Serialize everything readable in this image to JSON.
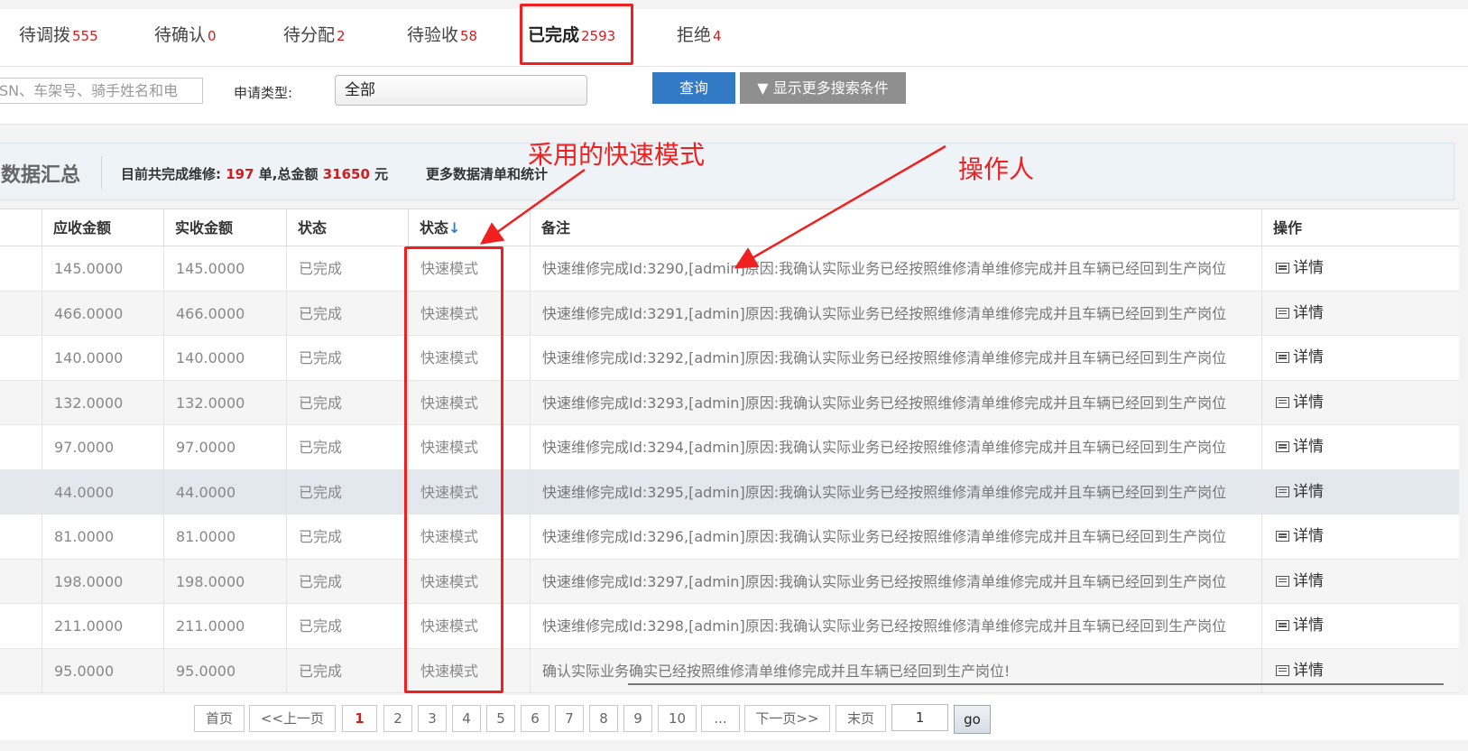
{
  "tabs": [
    {
      "label": "待调拨",
      "count": "555"
    },
    {
      "label": "待确认",
      "count": "0"
    },
    {
      "label": "待分配",
      "count": "2"
    },
    {
      "label": "待验收",
      "count": "58"
    },
    {
      "label": "已完成",
      "count": "2593"
    },
    {
      "label": "拒绝",
      "count": "4"
    }
  ],
  "search": {
    "placeholder": "SN、车架号、骑手姓名和电",
    "type_label": "申请类型:",
    "type_value": "全部",
    "query_label": "查询",
    "more_label": "▼ 显示更多搜索条件"
  },
  "summary": {
    "title": "数据汇总",
    "prefix": "目前共完成维修:",
    "count": "197",
    "mid": " 单,总金额 ",
    "amount": "31650",
    "suffix": " 元",
    "more_link": "更多数据清单和统计"
  },
  "table": {
    "headers": [
      "应收金额",
      "实收金额",
      "状态",
      "状态",
      "备注",
      "操作"
    ],
    "sort_icon": "↓",
    "rows": [
      [
        "145.0000",
        "145.0000",
        "已完成",
        "快速模式",
        "快速维修完成Id:3290,[admin]原因:我确认实际业务已经按照维修清单维修完成并且车辆已经回到生产岗位",
        "详情"
      ],
      [
        "466.0000",
        "466.0000",
        "已完成",
        "快速模式",
        "快速维修完成Id:3291,[admin]原因:我确认实际业务已经按照维修清单维修完成并且车辆已经回到生产岗位",
        "详情"
      ],
      [
        "140.0000",
        "140.0000",
        "已完成",
        "快速模式",
        "快速维修完成Id:3292,[admin]原因:我确认实际业务已经按照维修清单维修完成并且车辆已经回到生产岗位",
        "详情"
      ],
      [
        "132.0000",
        "132.0000",
        "已完成",
        "快速模式",
        "快速维修完成Id:3293,[admin]原因:我确认实际业务已经按照维修清单维修完成并且车辆已经回到生产岗位",
        "详情"
      ],
      [
        "97.0000",
        "97.0000",
        "已完成",
        "快速模式",
        "快速维修完成Id:3294,[admin]原因:我确认实际业务已经按照维修清单维修完成并且车辆已经回到生产岗位",
        "详情"
      ],
      [
        "44.0000",
        "44.0000",
        "已完成",
        "快速模式",
        "快速维修完成Id:3295,[admin]原因:我确认实际业务已经按照维修清单维修完成并且车辆已经回到生产岗位",
        "详情"
      ],
      [
        "81.0000",
        "81.0000",
        "已完成",
        "快速模式",
        "快速维修完成Id:3296,[admin]原因:我确认实际业务已经按照维修清单维修完成并且车辆已经回到生产岗位",
        "详情"
      ],
      [
        "198.0000",
        "198.0000",
        "已完成",
        "快速模式",
        "快速维修完成Id:3297,[admin]原因:我确认实际业务已经按照维修清单维修完成并且车辆已经回到生产岗位",
        "详情"
      ],
      [
        "211.0000",
        "211.0000",
        "已完成",
        "快速模式",
        "快速维修完成Id:3298,[admin]原因:我确认实际业务已经按照维修清单维修完成并且车辆已经回到生产岗位",
        "详情"
      ],
      [
        "95.0000",
        "95.0000",
        "已完成",
        "快速模式",
        "确认实际业务确实已经按照维修清单维修完成并且车辆已经回到生产岗位!",
        "详情"
      ]
    ]
  },
  "pager": {
    "first": "首页",
    "prev": "<<上一页",
    "pages": [
      "1",
      "2",
      "3",
      "4",
      "5",
      "6",
      "7",
      "8",
      "9",
      "10",
      "..."
    ],
    "next": "下一页>>",
    "last": "末页",
    "input_value": "1",
    "go": "go"
  },
  "annotations": {
    "mode_text": "采用的快速模式",
    "operator_text": "操作人",
    "color": "#f02020"
  }
}
